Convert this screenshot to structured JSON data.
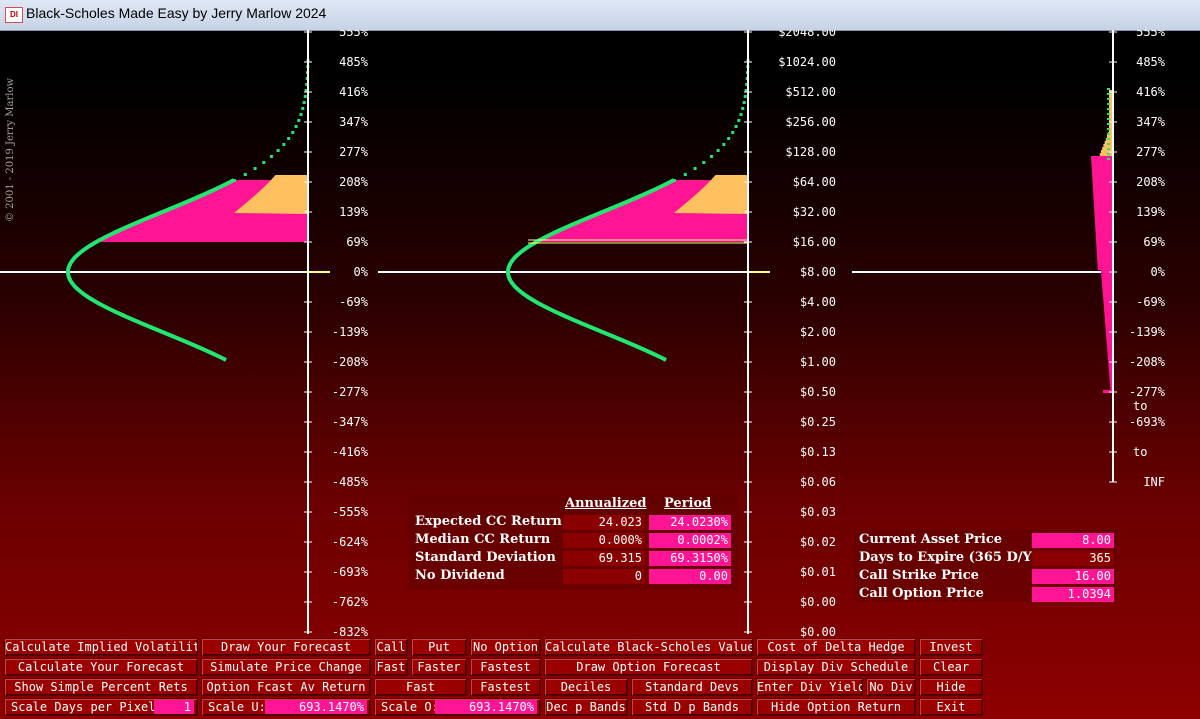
{
  "window": {
    "title": "Black-Scholes Made Easy by Jerry Marlow  2024",
    "icon": "DI"
  },
  "copyright": "© 2001 - 2019  Jerry Marlow",
  "colors": {
    "curve": "#22e66e",
    "pink": "#ff1493",
    "orange": "#ffc060",
    "axis": "#ffffff",
    "yellow_line": "#ffff80",
    "bg_top": "#000000",
    "bg_bottom": "#8e0000"
  },
  "left_axis": {
    "labels": [
      "555%",
      "485%",
      "416%",
      "347%",
      "277%",
      "208%",
      "139%",
      "69%",
      "0%",
      "-69%",
      "-139%",
      "-208%",
      "-277%",
      "-347%",
      "-416%",
      "-485%",
      "-555%",
      "-624%",
      "-693%",
      "-762%",
      "-832%"
    ]
  },
  "mid_axis": {
    "labels": [
      "$2048.00",
      "$1024.00",
      "$512.00",
      "$256.00",
      "$128.00",
      "$64.00",
      "$32.00",
      "$16.00",
      "$8.00",
      "$4.00",
      "$2.00",
      "$1.00",
      "$0.50",
      "$0.25",
      "$0.13",
      "$0.06",
      "$0.03",
      "$0.02",
      "$0.01",
      "$0.00",
      "$0.00"
    ]
  },
  "right_axis": {
    "labels": [
      "555%",
      "485%",
      "416%",
      "347%",
      "277%",
      "208%",
      "139%",
      "69%",
      "0%",
      "-69%",
      "-139%",
      "-208%",
      "-277%",
      "-693%",
      "",
      "INF"
    ],
    "extra_to": [
      "to",
      "to"
    ]
  },
  "returns_table": {
    "col_annualized": "Annualized",
    "col_period": "Period",
    "rows": [
      {
        "label": "Expected CC Return",
        "annualized": "24.023",
        "period": "24.0230%"
      },
      {
        "label": "Median CC Return",
        "annualized": "0.000%",
        "period": "0.0002%"
      },
      {
        "label": "Standard Deviation",
        "annualized": "69.315",
        "period": "69.3150%"
      },
      {
        "label": "No Dividend",
        "annualized": "0",
        "period": "0.00"
      }
    ]
  },
  "option_table": {
    "rows": [
      {
        "label": "Current Asset Price",
        "value": "8.00",
        "pink": true
      },
      {
        "label": "Days to Expire (365 D/Y)",
        "value": "365",
        "pink": false
      },
      {
        "label": "Call Strike Price",
        "value": "16.00",
        "pink": true
      },
      {
        "label": "Call Option Price",
        "value": "1.0394",
        "pink": true
      }
    ]
  },
  "buttons": {
    "calc_implied_vol": "Calculate Implied Volatility",
    "draw_forecast": "Draw Your Forecast",
    "call": "Call",
    "put": "Put",
    "no_option": "No Option",
    "calc_bs": "Calculate Black-Scholes Value",
    "cost_delta": "Cost of Delta Hedge",
    "invest": "Invest",
    "calc_forecast": "Calculate Your Forecast",
    "simulate": "Simulate Price Change",
    "fast1": "Fast",
    "faster": "Faster",
    "fastest1": "Fastest",
    "draw_option_forecast": "Draw Option Forecast",
    "display_div": "Display Div Schedule",
    "clear": "Clear",
    "show_simple": "Show Simple Percent Rets",
    "option_fcast": "Option Fcast Av Return",
    "fast2": "Fast",
    "fastest2": "Fastest",
    "deciles": "Deciles",
    "std_devs": "Standard Devs",
    "enter_div": "Enter Div Yield",
    "no_div": "No Div",
    "hide": "Hide",
    "scale_days_label": "Scale Days per Pixel:",
    "scale_days_value": "1",
    "scale_u_label": "Scale U:",
    "scale_u_value": "693.1470%",
    "scale_o_label": "Scale O:",
    "scale_o_value": "693.1470%",
    "dec_p_bands": "Dec p Bands",
    "std_d_p_bands": "Std D p Bands",
    "hide_option_return": "Hide Option Return",
    "exit": "Exit"
  }
}
